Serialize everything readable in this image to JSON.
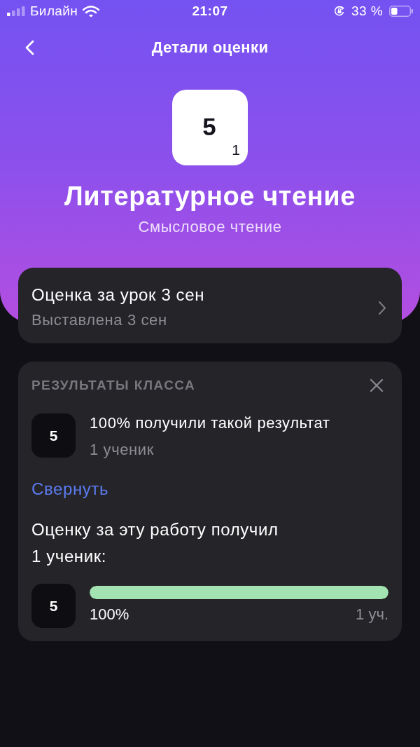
{
  "status_bar": {
    "carrier": "Билайн",
    "time": "21:07",
    "battery": "33 %"
  },
  "header": {
    "title": "Детали оценки"
  },
  "grade": {
    "value": "5",
    "weight": "1"
  },
  "subject": {
    "name": "Литературное чтение",
    "topic": "Смысловое чтение"
  },
  "lesson_card": {
    "title": "Оценка за урок 3 сен",
    "subtitle": "Выставлена 3 сен"
  },
  "class_results": {
    "title": "РЕЗУЛЬТАТЫ КЛАССА",
    "summary": [
      {
        "grade": "5",
        "text": "100% получили такой результат",
        "count": "1 ученик"
      }
    ],
    "collapse_link": "Свернуть",
    "caption": "Оценку за эту работу получил\n1 ученик:",
    "breakdown": [
      {
        "grade": "5",
        "level": 1,
        "percent": "100%",
        "count": "1 уч."
      }
    ]
  }
}
